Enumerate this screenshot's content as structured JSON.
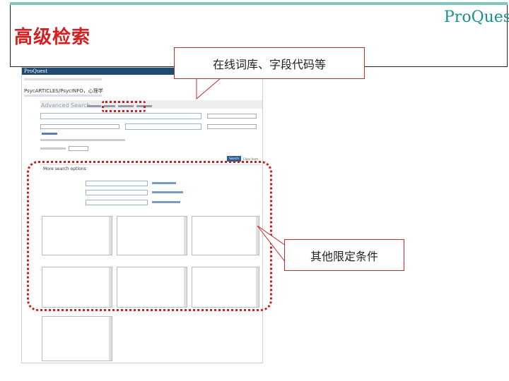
{
  "slide": {
    "title": "高级检索",
    "logo": "ProQuest",
    "callout_tabs": "在线词库、字段代码等",
    "callout_options": "其他限定条件"
  },
  "screenshot": {
    "logo": "ProQuest",
    "database_title": "PsycARTICLES/PsycINFO，心理学",
    "advanced_search_title": "Advanced Search",
    "search_button": "Search",
    "clear_button": "Clear form",
    "more_options_title": "More search options"
  },
  "colors": {
    "title_red": "#d81e1e",
    "highlight_red": "#c82020",
    "proquest_teal": "#1a8f8f",
    "app_bar": "#1f4b73"
  }
}
